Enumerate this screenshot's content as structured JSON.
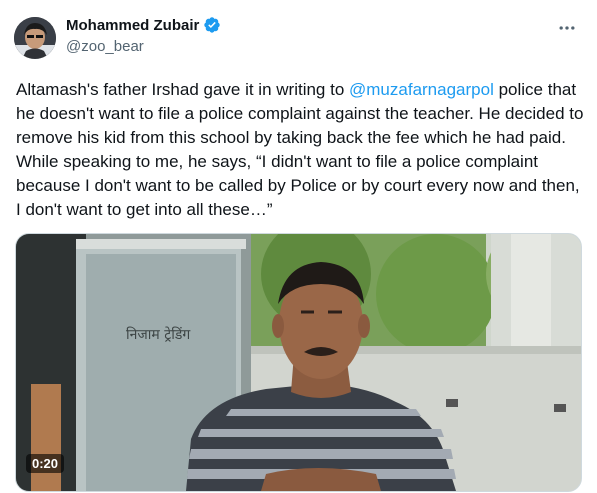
{
  "author": {
    "name": "Mohammed Zubair",
    "handle": "@zoo_bear",
    "verified": true,
    "avatar_icon": "avatar-photo"
  },
  "tweet": {
    "text_before": "Altamash's father Irshad gave it in writing to ",
    "mention": "@muzafarnagarpol",
    "text_after": " police that he doesn't want to file a police complaint against the teacher. He decided to remove his kid from this school by taking back the fee which he had paid. While speaking to me, he says, “I didn't want to file a police complaint because I don't want to be called by Police or by court every now and then, I don't want to get into all these…”"
  },
  "media": {
    "type": "video",
    "duration": "0:20",
    "sign_text": "निजाम ट्रेडिंग"
  },
  "colors": {
    "accent": "#1d9bf0",
    "text": "#0f1419",
    "secondary": "#536471"
  }
}
